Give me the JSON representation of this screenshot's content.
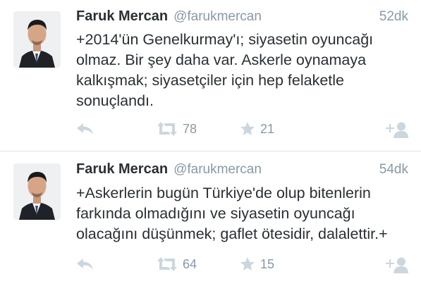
{
  "tweets": [
    {
      "name": "Faruk Mercan",
      "handle": "@farukmercan",
      "time": "52dk",
      "text": "+2014'ün Genelkurmay'ı; siyasetin oyuncağı olmaz. Bir şey daha var. Askerle oynamaya kalkışmak; siyasetçiler için hep felaketle sonuçlandı.",
      "retweets": "78",
      "favorites": "21"
    },
    {
      "name": "Faruk Mercan",
      "handle": "@farukmercan",
      "time": "54dk",
      "text": "+Askerlerin bugün Türkiye'de olup bitenlerin farkında olmadığını ve siyasetin oyuncağı olacağını düşünmek; gaflet ötesidir, dalalettir.+",
      "retweets": "64",
      "favorites": "15"
    }
  ],
  "icons": {
    "reply": "reply-arrow-icon",
    "retweet": "retweet-icon",
    "favorite": "star-icon",
    "follow": "follow-user-icon"
  },
  "colors": {
    "icon": "#ccd6dd",
    "meta": "#8899a6",
    "text": "#292f33",
    "divider": "#dfe3e6"
  }
}
